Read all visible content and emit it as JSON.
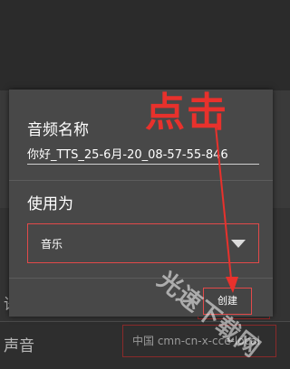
{
  "dialog": {
    "title": "音频名称",
    "name_value": "你好_TTS_25-6月-20_08-57-55-846",
    "use_as_label": "使用为",
    "use_as_selected": "音乐",
    "create_label": "创建"
  },
  "background": {
    "row_label_partial": "语",
    "voice_label": "声音",
    "voice_value": "中国 cmn-cn-x-cce-local"
  },
  "annotation": {
    "text": "点击",
    "color": "#e8312c"
  },
  "watermark": {
    "text": "光速下载网"
  },
  "colors": {
    "accent_red": "#e24a4a",
    "dialog_bg": "#484848"
  }
}
